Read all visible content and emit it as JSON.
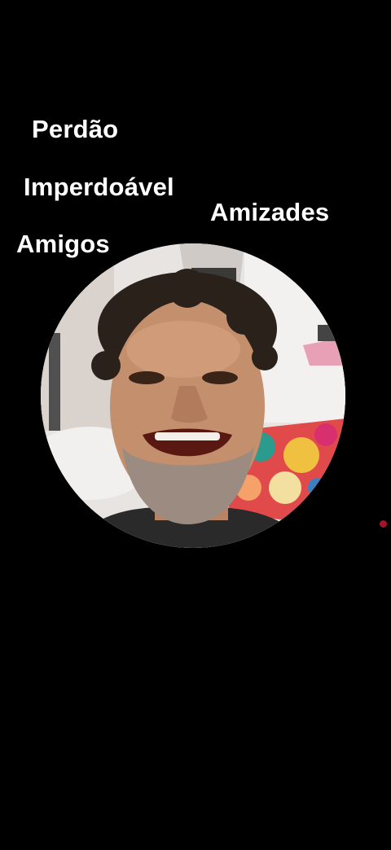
{
  "words": {
    "perdao": "Perdão",
    "imperdoavel": "Imperdoável",
    "amizades": "Amizades",
    "amigos": "Amigos"
  },
  "video": {
    "icon": "person-selfie-video"
  },
  "colors": {
    "background": "#000000",
    "text": "#ffffff",
    "indicator": "#a3142a"
  }
}
